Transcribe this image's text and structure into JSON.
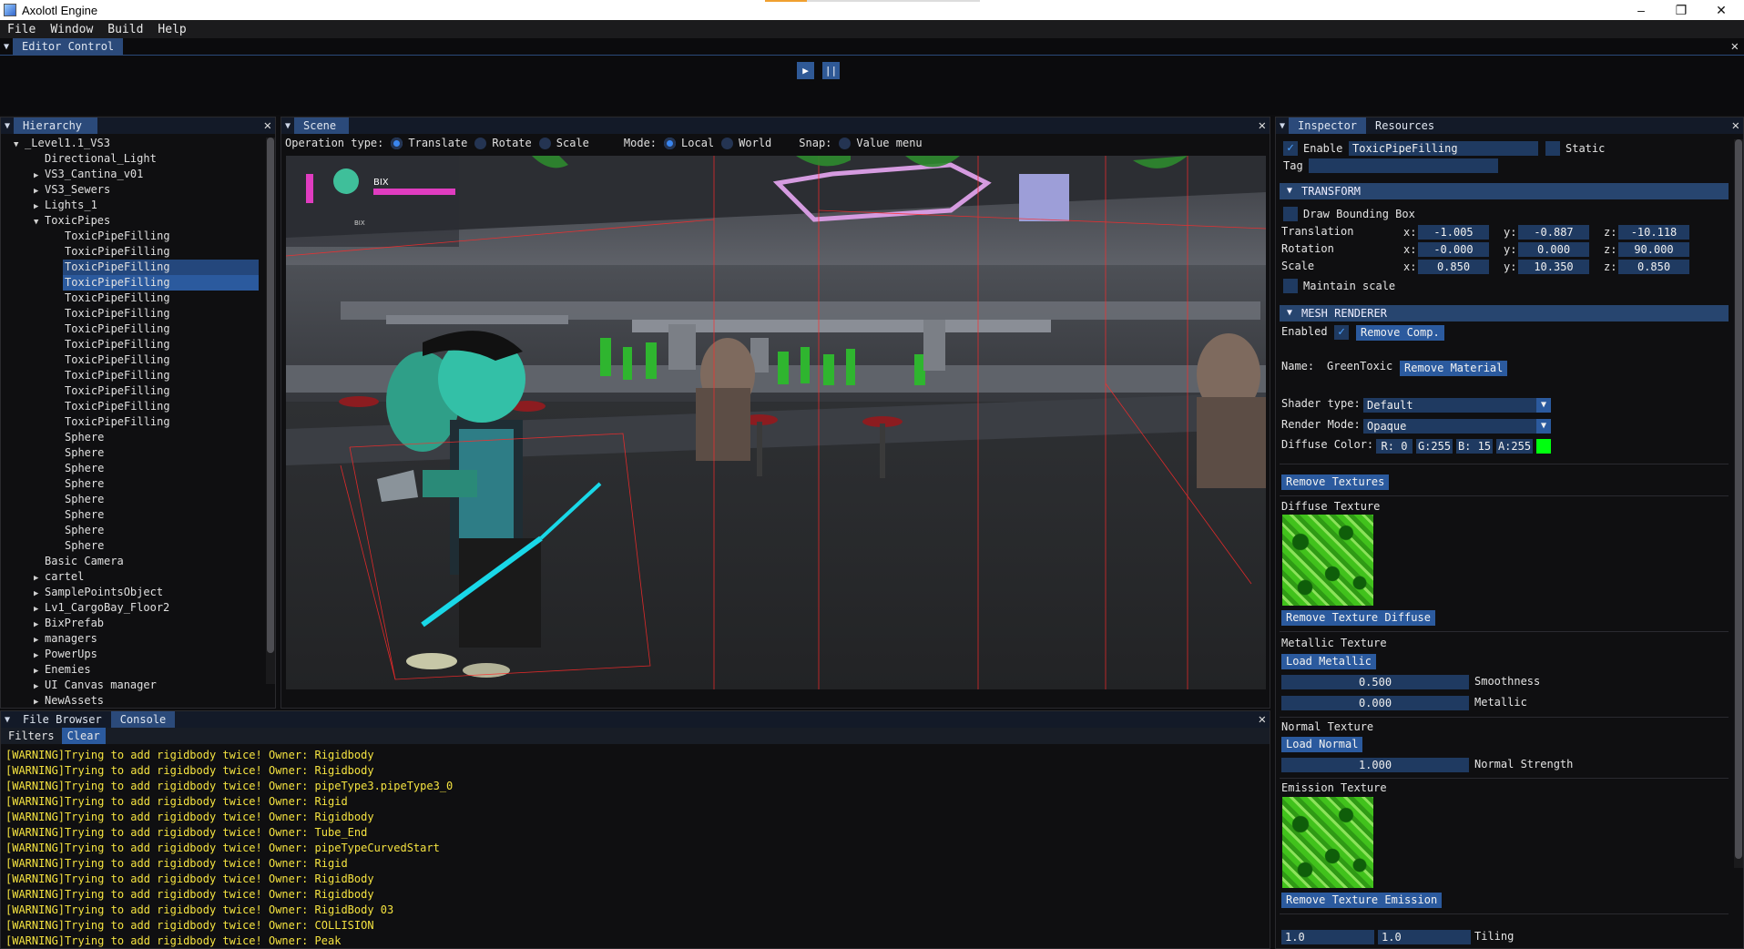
{
  "window": {
    "title": "Axolotl Engine",
    "minimize": "–",
    "restore": "❐",
    "close": "✕"
  },
  "menu": [
    "File",
    "Window",
    "Build",
    "Help"
  ],
  "editor_control": {
    "tab": "Editor Control",
    "play": "▶",
    "pause": "||",
    "close": "✕"
  },
  "hierarchy": {
    "tab": "Hierarchy",
    "close": "✕",
    "items": [
      {
        "label": "_Level1.1_VS3",
        "depth": 0,
        "arrow": "▼",
        "selected": false
      },
      {
        "label": "Directional_Light",
        "depth": 1,
        "arrow": "",
        "selected": false
      },
      {
        "label": "VS3_Cantina_v01",
        "depth": 1,
        "arrow": "▶",
        "selected": false
      },
      {
        "label": "VS3_Sewers",
        "depth": 1,
        "arrow": "▶",
        "selected": false
      },
      {
        "label": "Lights_1",
        "depth": 1,
        "arrow": "▶",
        "selected": false
      },
      {
        "label": "ToxicPipes",
        "depth": 1,
        "arrow": "▼",
        "selected": false
      },
      {
        "label": "ToxicPipeFilling",
        "depth": 2,
        "arrow": "",
        "selected": false
      },
      {
        "label": "ToxicPipeFilling",
        "depth": 2,
        "arrow": "",
        "selected": false
      },
      {
        "label": "ToxicPipeFilling",
        "depth": 2,
        "arrow": "",
        "selected": "dim"
      },
      {
        "label": "ToxicPipeFilling",
        "depth": 2,
        "arrow": "",
        "selected": true
      },
      {
        "label": "ToxicPipeFilling",
        "depth": 2,
        "arrow": "",
        "selected": false
      },
      {
        "label": "ToxicPipeFilling",
        "depth": 2,
        "arrow": "",
        "selected": false
      },
      {
        "label": "ToxicPipeFilling",
        "depth": 2,
        "arrow": "",
        "selected": false
      },
      {
        "label": "ToxicPipeFilling",
        "depth": 2,
        "arrow": "",
        "selected": false
      },
      {
        "label": "ToxicPipeFilling",
        "depth": 2,
        "arrow": "",
        "selected": false
      },
      {
        "label": "ToxicPipeFilling",
        "depth": 2,
        "arrow": "",
        "selected": false
      },
      {
        "label": "ToxicPipeFilling",
        "depth": 2,
        "arrow": "",
        "selected": false
      },
      {
        "label": "ToxicPipeFilling",
        "depth": 2,
        "arrow": "",
        "selected": false
      },
      {
        "label": "ToxicPipeFilling",
        "depth": 2,
        "arrow": "",
        "selected": false
      },
      {
        "label": "Sphere",
        "depth": 2,
        "arrow": "",
        "selected": false
      },
      {
        "label": "Sphere",
        "depth": 2,
        "arrow": "",
        "selected": false
      },
      {
        "label": "Sphere",
        "depth": 2,
        "arrow": "",
        "selected": false
      },
      {
        "label": "Sphere",
        "depth": 2,
        "arrow": "",
        "selected": false
      },
      {
        "label": "Sphere",
        "depth": 2,
        "arrow": "",
        "selected": false
      },
      {
        "label": "Sphere",
        "depth": 2,
        "arrow": "",
        "selected": false
      },
      {
        "label": "Sphere",
        "depth": 2,
        "arrow": "",
        "selected": false
      },
      {
        "label": "Sphere",
        "depth": 2,
        "arrow": "",
        "selected": false
      },
      {
        "label": "Basic Camera",
        "depth": 1,
        "arrow": "",
        "selected": false
      },
      {
        "label": "cartel",
        "depth": 1,
        "arrow": "▶",
        "selected": false
      },
      {
        "label": "SamplePointsObject",
        "depth": 1,
        "arrow": "▶",
        "selected": false
      },
      {
        "label": "Lv1_CargoBay_Floor2",
        "depth": 1,
        "arrow": "▶",
        "selected": false
      },
      {
        "label": "BixPrefab",
        "depth": 1,
        "arrow": "▶",
        "selected": false
      },
      {
        "label": "managers",
        "depth": 1,
        "arrow": "▶",
        "selected": false
      },
      {
        "label": "PowerUps",
        "depth": 1,
        "arrow": "▶",
        "selected": false
      },
      {
        "label": "Enemies",
        "depth": 1,
        "arrow": "▶",
        "selected": false
      },
      {
        "label": "UI Canvas manager",
        "depth": 1,
        "arrow": "▶",
        "selected": false
      },
      {
        "label": "NewAssets",
        "depth": 1,
        "arrow": "▶",
        "selected": false
      }
    ]
  },
  "scene": {
    "tab": "Scene",
    "close": "✕",
    "operation_label": "Operation type:",
    "op_translate": "Translate",
    "op_rotate": "Rotate",
    "op_scale": "Scale",
    "mode_label": "Mode:",
    "mode_local": "Local",
    "mode_world": "World",
    "snap_label": "Snap:",
    "value_menu": "Value menu",
    "hud_name": "BIX",
    "hud_name2": "BIX"
  },
  "inspector": {
    "tab_inspector": "Inspector",
    "tab_resources": "Resources",
    "close": "✕",
    "enable_label": "Enable",
    "object_name": "ToxicPipeFilling",
    "static_label": "Static",
    "tag_label": "Tag",
    "tag_value": "",
    "transform_header": "TRANSFORM",
    "draw_bbox": "Draw Bounding Box",
    "translation_label": "Translation",
    "rotation_label": "Rotation",
    "scale_label": "Scale",
    "x": "x:",
    "y": "y:",
    "z": "z:",
    "translation": [
      "-1.005",
      "-0.887",
      "-10.118"
    ],
    "rotation": [
      "-0.000",
      "0.000",
      "90.000"
    ],
    "scale": [
      "0.850",
      "10.350",
      "0.850"
    ],
    "maintain_scale": "Maintain scale",
    "mesh_header": "MESH RENDERER",
    "enabled_label": "Enabled",
    "remove_comp": "Remove Comp.",
    "name_label": "Name:",
    "material_name": "GreenToxic",
    "remove_material": "Remove Material",
    "shader_label": "Shader type:",
    "shader_value": "Default",
    "render_mode_label": "Render Mode:",
    "render_mode_value": "Opaque",
    "diffuse_color_label": "Diffuse Color:",
    "color_r": "R:  0",
    "color_g": "G:255",
    "color_b": "B: 15",
    "color_a": "A:255",
    "swatch_color": "#00ff0f",
    "remove_textures": "Remove Textures",
    "diffuse_texture_label": "Diffuse Texture",
    "remove_texture_diffuse": "Remove Texture Diffuse",
    "metallic_texture_label": "Metallic Texture",
    "load_metallic": "Load Metallic",
    "smoothness_value": "0.500",
    "smoothness_label": "Smoothness",
    "metallic_value": "0.000",
    "metallic_label": "Metallic",
    "normal_texture_label": "Normal Texture",
    "load_normal": "Load Normal",
    "normal_strength_value": "1.000",
    "normal_strength_label": "Normal Strength",
    "emission_texture_label": "Emission Texture",
    "remove_texture_emission": "Remove Texture Emission",
    "tiling_x": "1.0",
    "tiling_y": "1.0",
    "tiling_label": "Tiling"
  },
  "console": {
    "tab_file_browser": "File Browser",
    "tab_console": "Console",
    "close": "✕",
    "filters": "Filters",
    "clear": "Clear",
    "lines": [
      "[WARNING]Trying to add rigidbody twice! Owner: Rigidbody",
      "[WARNING]Trying to add rigidbody twice! Owner: Rigidbody",
      "[WARNING]Trying to add rigidbody twice! Owner: pipeType3.pipeType3_0",
      "[WARNING]Trying to add rigidbody twice! Owner: Rigid",
      "[WARNING]Trying to add rigidbody twice! Owner: Rigidbody",
      "[WARNING]Trying to add rigidbody twice! Owner: Tube_End",
      "[WARNING]Trying to add rigidbody twice! Owner: pipeTypeCurvedStart",
      "[WARNING]Trying to add rigidbody twice! Owner: Rigid",
      "[WARNING]Trying to add rigidbody twice! Owner: RigidBody",
      "[WARNING]Trying to add rigidbody twice! Owner: Rigidbody",
      "[WARNING]Trying to add rigidbody twice! Owner: RigidBody 03",
      "[WARNING]Trying to add rigidbody twice! Owner: COLLISION",
      "[WARNING]Trying to add rigidbody twice! Owner: Peak"
    ]
  }
}
